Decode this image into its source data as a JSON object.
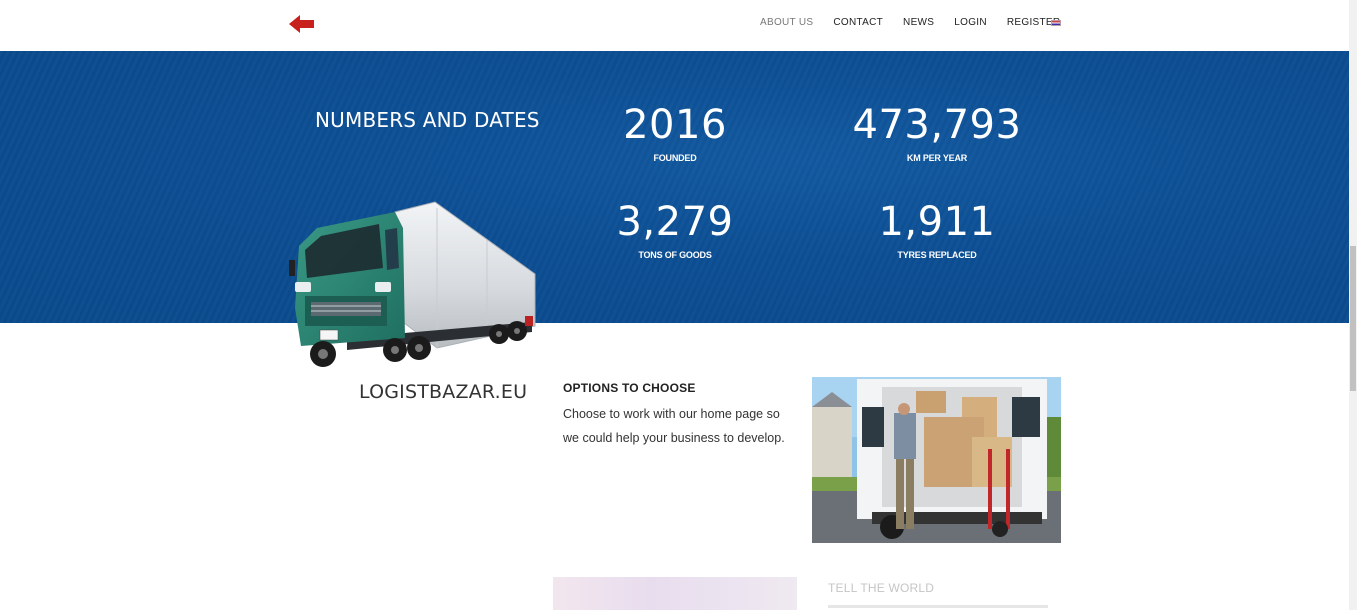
{
  "header": {
    "logo_icon": "red-left-arrow-icon",
    "nav": [
      "ABOUT US",
      "CONTACT",
      "NEWS",
      "LOGIN",
      "REGISTER"
    ],
    "active_nav": "ABOUT US",
    "language_flag": "uk-flag-icon"
  },
  "stats_section": {
    "title": "NUMBERS AND DATES",
    "stats": [
      {
        "value": "2016",
        "label": "FOUNDED"
      },
      {
        "value": "473,793",
        "label": "KM PER YEAR"
      },
      {
        "value": "3,279",
        "label": "TONS OF GOODS"
      },
      {
        "value": "1,911",
        "label": "TYRES REPLACED"
      }
    ],
    "background_color": "#0c4e93"
  },
  "site_name": "LOGISTBAZAR.EU",
  "options": {
    "title": "OPTIONS TO CHOOSE",
    "text": "Choose to work with our home page so we could help your business to develop."
  },
  "tell": {
    "title": "TELL THE WORLD"
  },
  "colors": {
    "accent_red": "#c8201c",
    "band_blue": "#0c4e93"
  }
}
